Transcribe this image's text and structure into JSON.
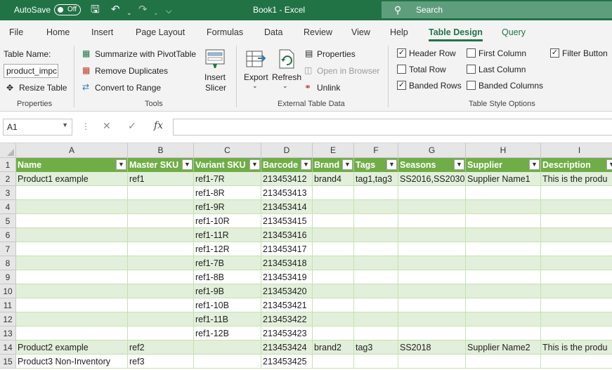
{
  "titlebar": {
    "autosave_label": "AutoSave",
    "autosave_state": "Off",
    "document_title": "Book1  -  Excel",
    "search_placeholder": "Search"
  },
  "tabs": [
    "File",
    "Home",
    "Insert",
    "Page Layout",
    "Formulas",
    "Data",
    "Review",
    "View",
    "Help",
    "Table Design",
    "Query"
  ],
  "active_tab": "Table Design",
  "ribbon": {
    "properties": {
      "table_name_label": "Table Name:",
      "table_name_value": "product_impc",
      "resize_label": "Resize Table",
      "group_label": "Properties"
    },
    "tools": {
      "summarize_label": "Summarize with PivotTable",
      "remove_duplicates_label": "Remove Duplicates",
      "convert_label": "Convert to Range",
      "insert_slicer_line1": "Insert",
      "insert_slicer_line2": "Slicer",
      "group_label": "Tools"
    },
    "external": {
      "export_label": "Export",
      "refresh_label": "Refresh",
      "properties_label": "Properties",
      "open_browser_label": "Open in Browser",
      "unlink_label": "Unlink",
      "group_label": "External Table Data"
    },
    "style_options": {
      "header_row": {
        "label": "Header Row",
        "checked": true
      },
      "total_row": {
        "label": "Total Row",
        "checked": false
      },
      "banded_rows": {
        "label": "Banded Rows",
        "checked": true
      },
      "first_column": {
        "label": "First Column",
        "checked": false
      },
      "last_column": {
        "label": "Last Column",
        "checked": false
      },
      "banded_columns": {
        "label": "Banded Columns",
        "checked": false
      },
      "filter_button": {
        "label": "Filter Button",
        "checked": true
      },
      "group_label": "Table Style Options"
    }
  },
  "formula_bar": {
    "name_box": "A1",
    "formula": ""
  },
  "sheet": {
    "columns": [
      "A",
      "B",
      "C",
      "D",
      "E",
      "F",
      "G",
      "H",
      "I"
    ],
    "rows": [
      [
        "Name",
        "Master SKU",
        "Variant SKU",
        "Barcode",
        "Brand",
        "Tags",
        "Seasons",
        "Supplier",
        "Description"
      ],
      [
        "Product1 example",
        "ref1",
        "ref1-7R",
        "213453412",
        "brand4",
        "tag1,tag3",
        "SS2016,SS2030",
        "Supplier Name1",
        "This is the produ"
      ],
      [
        "",
        "",
        "ref1-8R",
        "213453413",
        "",
        "",
        "",
        "",
        ""
      ],
      [
        "",
        "",
        "ref1-9R",
        "213453414",
        "",
        "",
        "",
        "",
        ""
      ],
      [
        "",
        "",
        "ref1-10R",
        "213453415",
        "",
        "",
        "",
        "",
        ""
      ],
      [
        "",
        "",
        "ref1-11R",
        "213453416",
        "",
        "",
        "",
        "",
        ""
      ],
      [
        "",
        "",
        "ref1-12R",
        "213453417",
        "",
        "",
        "",
        "",
        ""
      ],
      [
        "",
        "",
        "ref1-7B",
        "213453418",
        "",
        "",
        "",
        "",
        ""
      ],
      [
        "",
        "",
        "ref1-8B",
        "213453419",
        "",
        "",
        "",
        "",
        ""
      ],
      [
        "",
        "",
        "ref1-9B",
        "213453420",
        "",
        "",
        "",
        "",
        ""
      ],
      [
        "",
        "",
        "ref1-10B",
        "213453421",
        "",
        "",
        "",
        "",
        ""
      ],
      [
        "",
        "",
        "ref1-11B",
        "213453422",
        "",
        "",
        "",
        "",
        ""
      ],
      [
        "",
        "",
        "ref1-12B",
        "213453423",
        "",
        "",
        "",
        "",
        ""
      ],
      [
        "Product2 example",
        "ref2",
        "",
        "213453424",
        "brand2",
        "tag3",
        "SS2018",
        "Supplier Name2",
        "This is the produ"
      ],
      [
        "Product3 Non-Inventory",
        "ref3",
        "",
        "213453425",
        "",
        "",
        "",
        "",
        ""
      ]
    ]
  },
  "colors": {
    "excel_green": "#217346",
    "table_header": "#70ad47",
    "band": "#e2efda"
  }
}
